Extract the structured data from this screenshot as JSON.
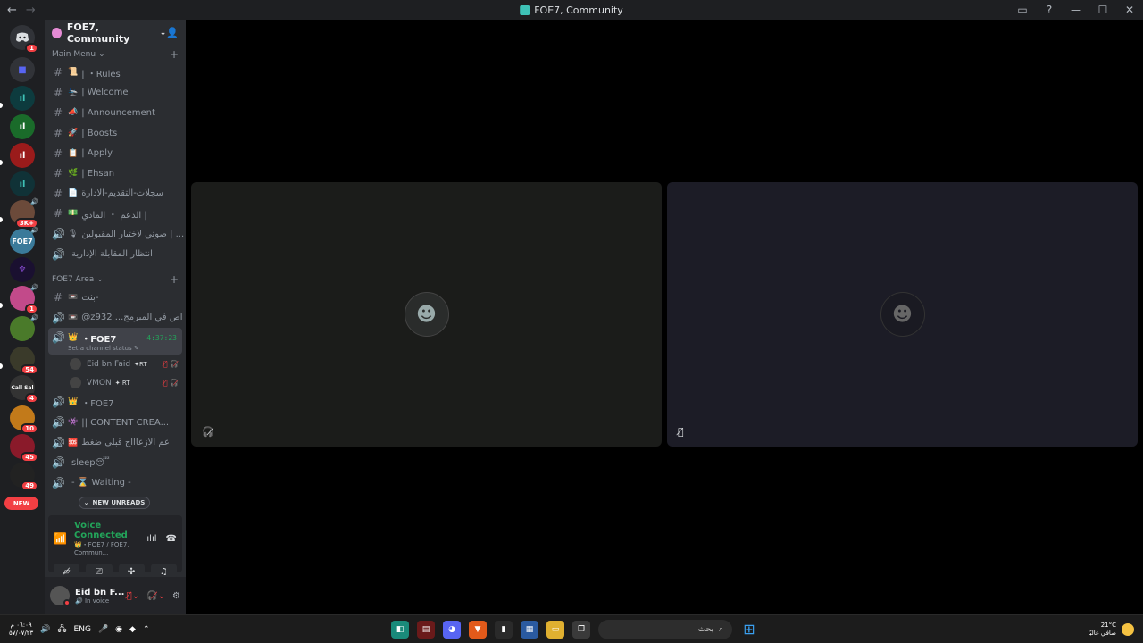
{
  "titlebar": {
    "back": "←",
    "forward": "→",
    "title": "FOE7, Community",
    "inbox_icon": "inbox-icon",
    "help_icon": "help-icon",
    "minimize": "—",
    "maximize": "☐",
    "close": "✕"
  },
  "rail": {
    "servers": [
      {
        "label": "",
        "badge": "1"
      },
      {
        "label": "",
        "badge": ""
      },
      {
        "label": "",
        "badge": ""
      },
      {
        "label": "",
        "badge": ""
      },
      {
        "label": "",
        "badge": ""
      },
      {
        "label": "",
        "badge": ""
      },
      {
        "label": "",
        "badge": "3K+"
      },
      {
        "label": "FOE7",
        "badge": ""
      },
      {
        "label": "",
        "badge": ""
      },
      {
        "label": "",
        "badge": "1"
      },
      {
        "label": "",
        "badge": ""
      },
      {
        "label": "",
        "badge": "54"
      },
      {
        "label": "Call Sal",
        "badge": "4"
      },
      {
        "label": "",
        "badge": "10"
      },
      {
        "label": "",
        "badge": "45"
      },
      {
        "label": "",
        "badge": "49"
      }
    ],
    "new_label": "NEW"
  },
  "guild": {
    "name": "FOE7, Community",
    "chevron": "⌄"
  },
  "categories": {
    "main": "Main Menu",
    "area": "FOE7 Area"
  },
  "main_channels": [
    {
      "type": "#",
      "emoji": "📜",
      "name": "| ・Rules"
    },
    {
      "type": "#",
      "emoji": "🛬",
      "name": "| Welcome"
    },
    {
      "type": "#",
      "emoji": "📣",
      "name": "| Announcement"
    },
    {
      "type": "#",
      "emoji": "🚀",
      "name": "| Boosts"
    },
    {
      "type": "#",
      "emoji": "📋",
      "name": "| Apply"
    },
    {
      "type": "#",
      "emoji": "🌿",
      "name": "| Ehsan"
    },
    {
      "type": "#",
      "emoji": "📄",
      "name": "سجلات-التقديم-الادارة"
    },
    {
      "type": "#",
      "emoji": "💵",
      "name": "الدعم ・ المادي |"
    },
    {
      "type": "🔊",
      "emoji": "🎙",
      "name": "صوتي لاختبار المقبولين | ..."
    },
    {
      "type": "🔊",
      "emoji": "",
      "name": "انتظار المقابلة الإدارية"
    }
  ],
  "area_channels": [
    {
      "type": "#",
      "emoji": "📼",
      "name": "بثث-"
    },
    {
      "type": "🔊",
      "emoji": "📼",
      "name": "@z932 ...اص في المبرمج"
    }
  ],
  "active_channel": {
    "emoji": "👑",
    "name": "・FOE7",
    "timer": "4:37:23",
    "status": "Set a channel status ✎"
  },
  "members": [
    {
      "name": "Eid bn Faid",
      "tag": "✦RT",
      "icons": "🎙̸ 🎧̸"
    },
    {
      "name": "VMON",
      "tag": "✦ RT",
      "icons": "🎙̸ 🎧̸"
    }
  ],
  "after_channels": [
    {
      "type": "🔊",
      "emoji": "👑",
      "name": "・FOE7"
    },
    {
      "type": "🔊",
      "emoji": "👾",
      "name": "|| CONTENT CREA..."
    },
    {
      "type": "🔊",
      "emoji": "🆘",
      "name": "عم الازعاااج قبلي ضغط"
    },
    {
      "type": "🔊",
      "emoji": "",
      "name": "sleep😴"
    },
    {
      "type": "🔊",
      "emoji": "",
      "name": "- ⌛ Waiting -"
    }
  ],
  "new_unreads": "NEW UNREADS",
  "voice": {
    "title": "Voice Connected",
    "sub": "👑・FOE7 / FOE7, Commun...",
    "noise_icon": "soundwave-icon",
    "disconnect_icon": "phone-hangup-icon"
  },
  "user": {
    "name": "Eid bn F...",
    "status": "In voice"
  },
  "tiles": [
    {
      "avatar": "☻"
    },
    {
      "avatar": "☻"
    }
  ],
  "taskbar": {
    "clock_time": "٠٦:٠٩ م",
    "clock_date": "٥٧/٠٧/٢٣",
    "lang": "ENG",
    "search_placeholder": "بحث",
    "temp": "21°C",
    "weather_text": "صافي غالبًا"
  }
}
